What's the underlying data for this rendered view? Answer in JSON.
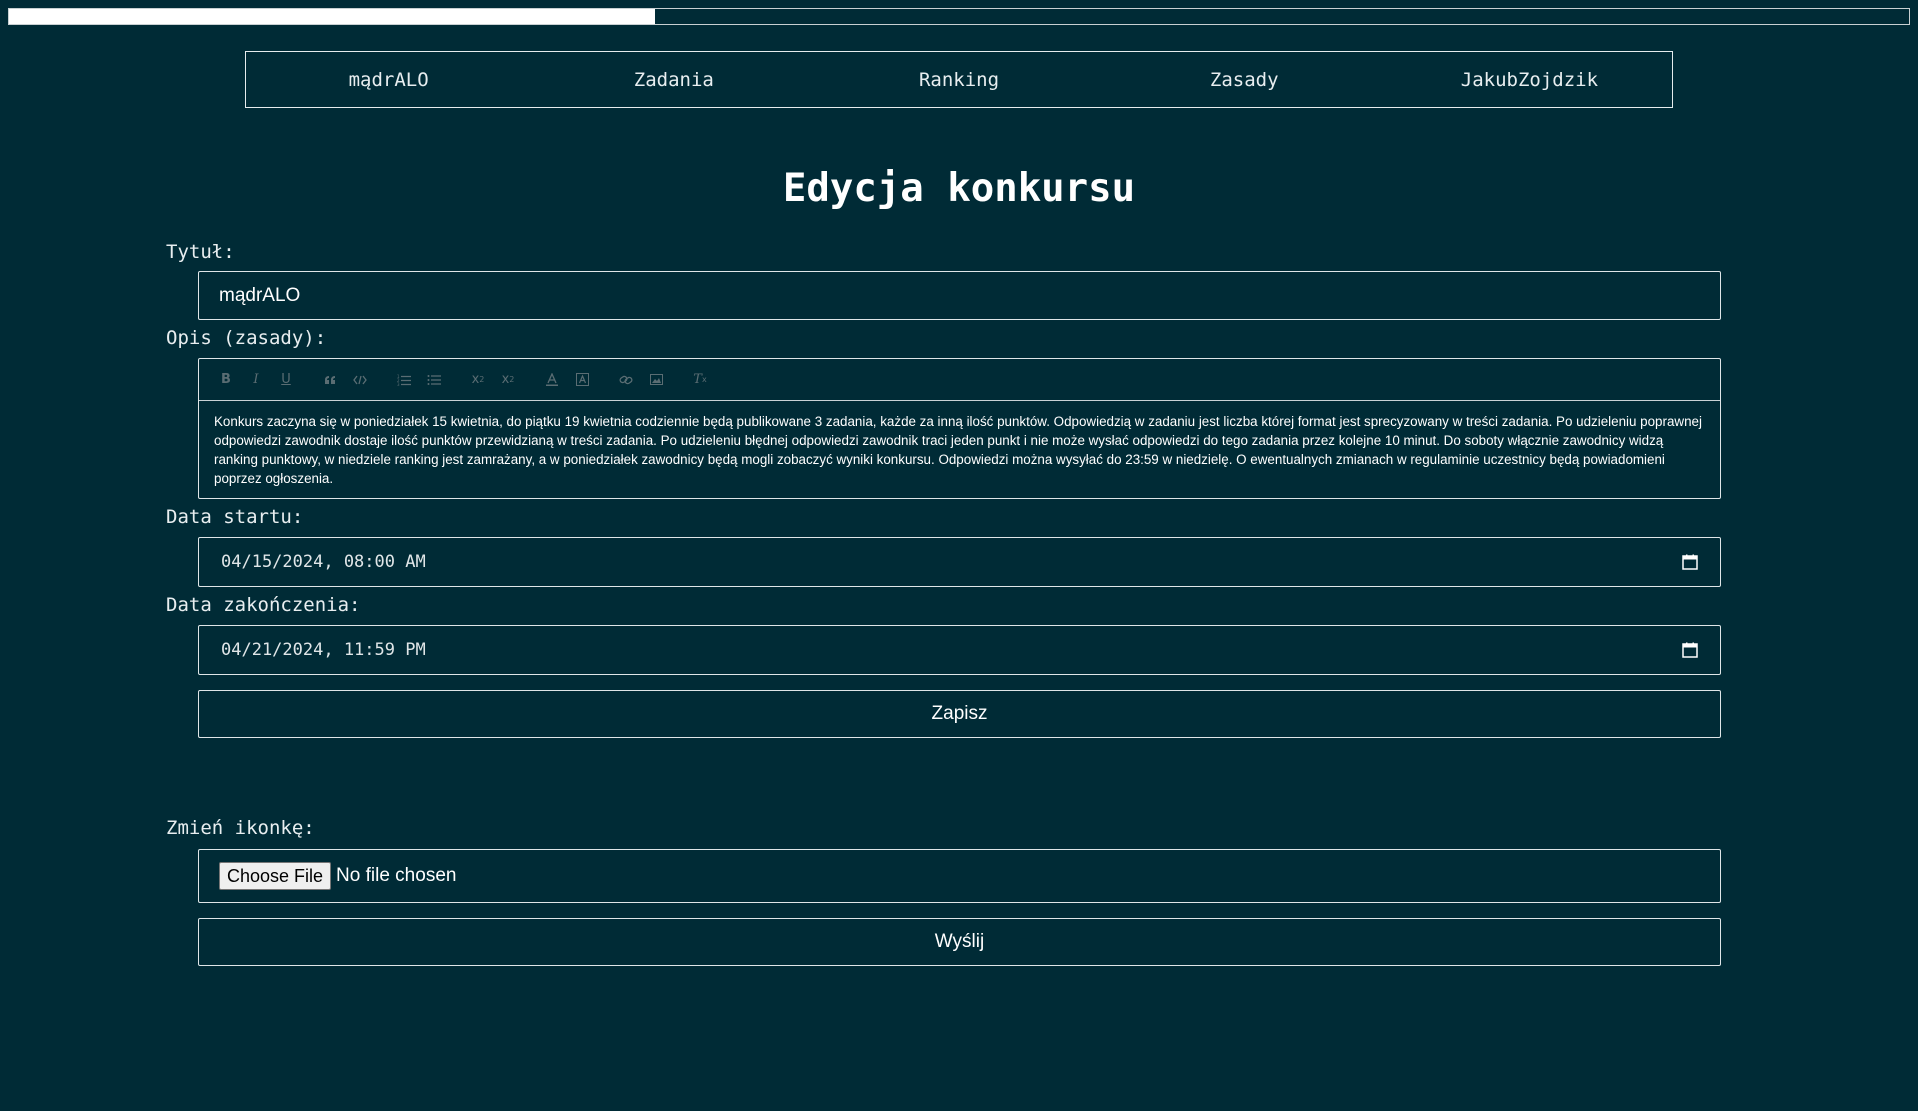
{
  "progress": {
    "fraction": 0.34
  },
  "nav": {
    "items": [
      "mądrALO",
      "Zadania",
      "Ranking",
      "Zasady",
      "JakubZojdzik"
    ]
  },
  "page": {
    "title": "Edycja konkursu"
  },
  "form": {
    "title_label": "Tytuł:",
    "title_value": "mądrALO",
    "desc_label": "Opis (zasady):",
    "desc_text": "Konkurs zaczyna się w poniedziałek 15 kwietnia, do piątku 19 kwietnia codziennie będą publikowane 3 zadania, każde za inną ilość punktów. Odpowiedzią w zadaniu jest liczba której format jest sprecyzowany w treści zadania. Po udzieleniu poprawnej odpowiedzi zawodnik dostaje ilość punktów przewidzianą w treści zadania. Po udzieleniu błędnej odpowiedzi zawodnik traci jeden punkt i nie może wysłać odpowiedzi do tego zadania przez kolejne 10 minut. Do soboty włącznie zawodnicy widzą ranking punktowy, w niedziele ranking jest zamrażany, a w poniedziałek zawodnicy będą mogli zobaczyć wyniki konkursu. Odpowiedzi można wysyłać do 23:59 w niedzielę. O ewentualnych zmianach w regulaminie uczestnicy będą powiadomieni poprzez ogłoszenia.",
    "start_label": "Data startu:",
    "start_value": "04/15/2024, 08:00 AM",
    "end_label": "Data zakończenia:",
    "end_value": "04/21/2024, 11:59 PM",
    "save_label": "Zapisz"
  },
  "toolbar": {
    "icons": [
      "bold-icon",
      "italic-icon",
      "underline-icon",
      "blockquote-icon",
      "code-block-icon",
      "ordered-list-icon",
      "bullet-list-icon",
      "subscript-icon",
      "superscript-icon",
      "text-color-icon",
      "background-color-icon",
      "link-icon",
      "image-icon",
      "clear-format-icon"
    ]
  },
  "icon_form": {
    "label": "Zmień ikonkę:",
    "choose_label": "Choose File",
    "status": "No file chosen",
    "send_label": "Wyślij"
  },
  "colors": {
    "background": "#002b36",
    "text": "#ffffff",
    "border": "#dfe6e8",
    "toolbar_icon": "#5a6d73"
  }
}
